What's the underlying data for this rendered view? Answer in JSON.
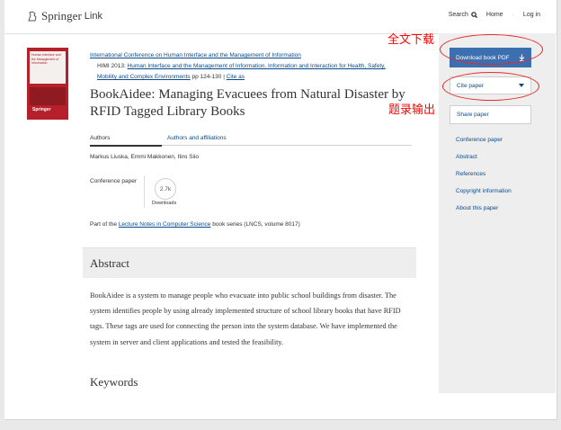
{
  "header": {
    "brand_part1": "Springer",
    "brand_part2": "Link",
    "nav": {
      "search": "Search",
      "home": "Home",
      "login": "Log in"
    }
  },
  "book": {
    "cover_text": "Human Interface and the Management of Information",
    "publisher": "Springer"
  },
  "conference": {
    "line1": "International Conference on Human Interface and the Management of Information",
    "prefix": "HIMI 2013:",
    "line2": "Human Interface and the Management of Information. Information and Interaction for Health, Safety,",
    "line3": "Mobility and Complex Environments",
    "pages": "pp 124-130",
    "cite_link": "Cite as"
  },
  "paper": {
    "title": "BookAidee: Managing Evacuees from Natural Disaster by RFID Tagged Library Books",
    "tabs": [
      "Authors",
      "Authors and affiliations"
    ],
    "authors": "Markus Liuska, Emmi Makkonen, Itiro Siio",
    "type": "Conference paper",
    "downloads_count": "2.7k",
    "downloads_label": "Downloads",
    "series_prefix": "Part of the",
    "series_link": "Lecture Notes in Computer Science",
    "series_suffix": "book series (LNCS, volume 8017)"
  },
  "abstract": {
    "heading": "Abstract",
    "text": "BookAidee is a system to manage people who evacuate into public school buildings from disaster. The system identifies people by using already implemented structure of school library books that have RFID tags. These tags are used for connecting the person into the system database. We have implemented the system in server and client applications and tested the feasibility."
  },
  "keywords_heading": "Keywords",
  "sidebar": {
    "download_label": "Download book PDF",
    "download_icon": "download-arrow-icon",
    "cite_label": "Cite paper",
    "cite_icon": "caret-down-icon",
    "share_label": "Share paper",
    "links": [
      "Conference paper",
      "Abstract",
      "References",
      "Copyright information",
      "About this paper"
    ]
  },
  "annotations": {
    "download": "全文下载",
    "cite": "题录输出",
    "color": "#ff0000"
  },
  "colors": {
    "link": "#0a4a8c",
    "primary_button": "#3c6fb0",
    "sidebar_bg": "#eeeeee",
    "cover": "#b5202a"
  }
}
